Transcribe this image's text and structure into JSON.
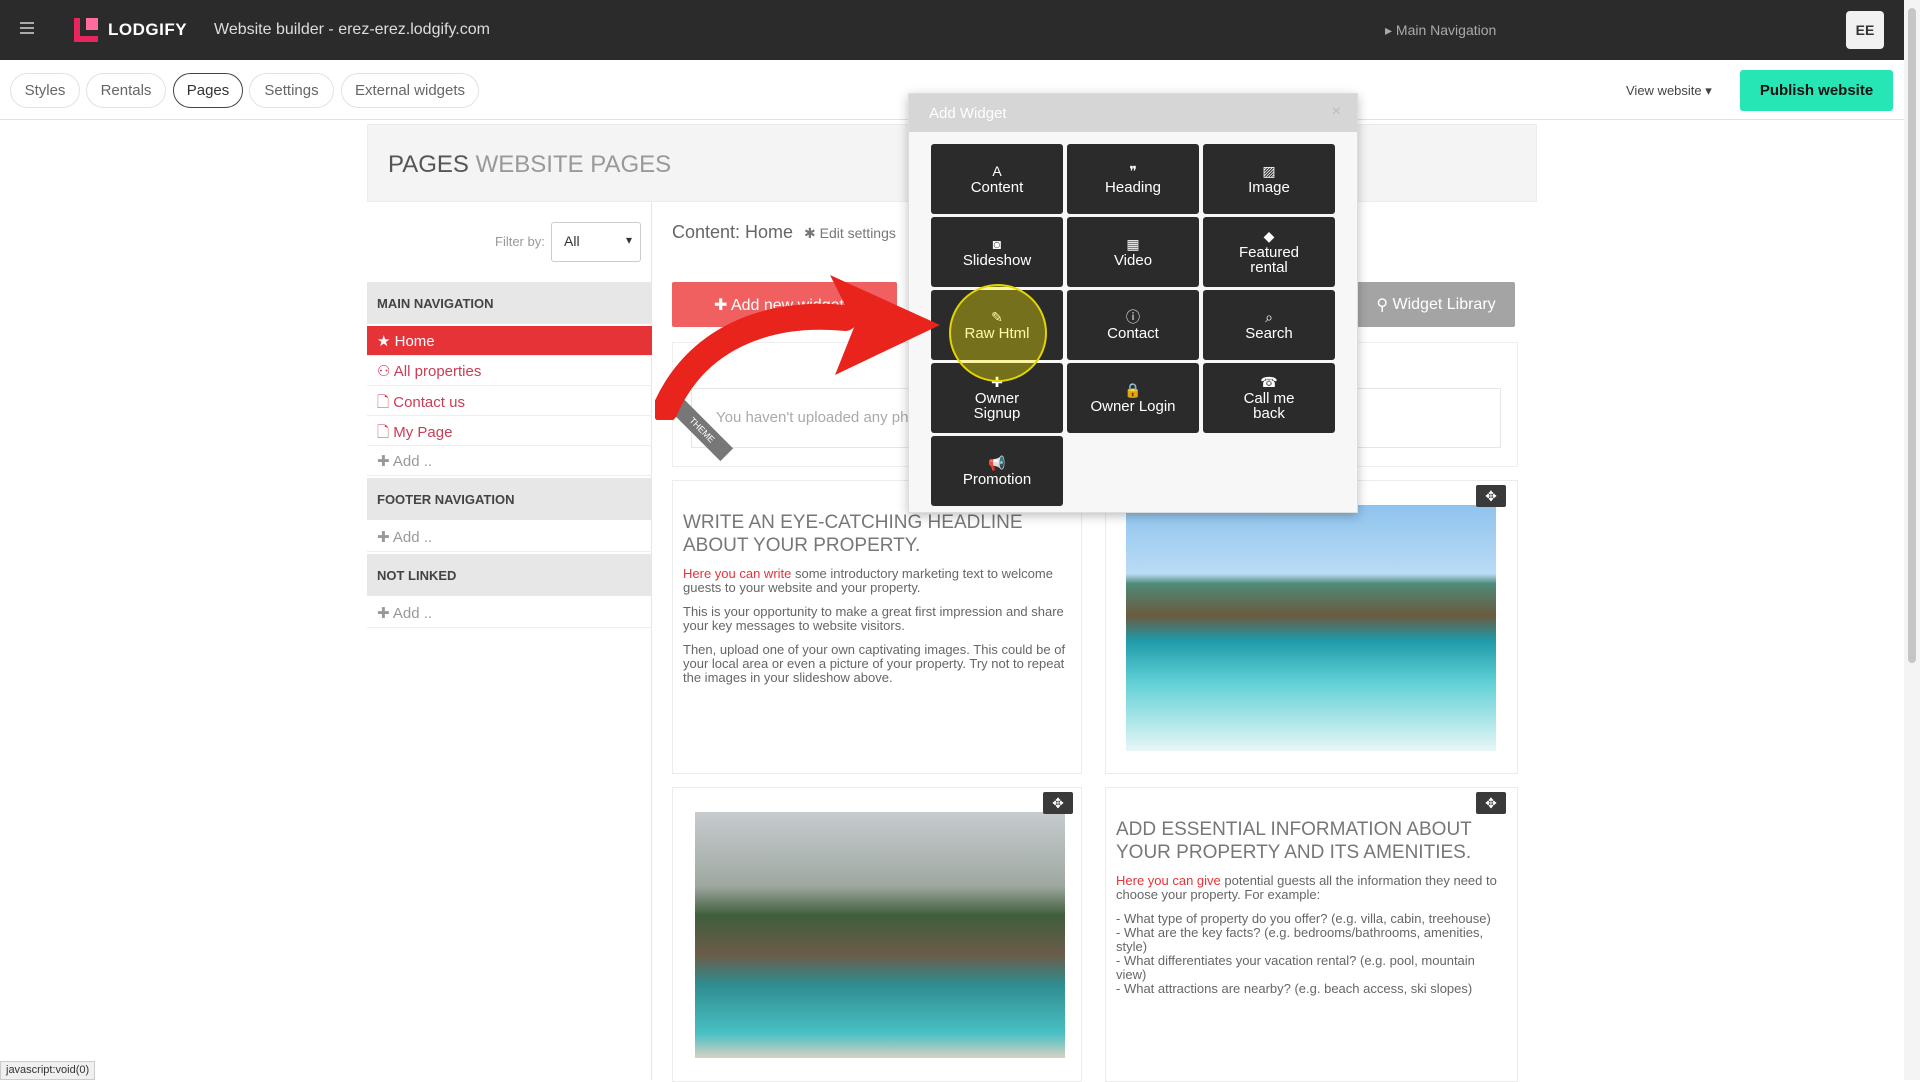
{
  "topbar": {
    "logo": "LODGIFY",
    "title": "Website builder - erez-erez.lodgify.com",
    "avatar": "EE"
  },
  "toolbar": {
    "tabs": [
      {
        "label": "Styles"
      },
      {
        "label": "Rentals"
      },
      {
        "label": "Pages"
      },
      {
        "label": "Settings"
      },
      {
        "label": "External widgets"
      }
    ],
    "view_website": "View website ▾",
    "publish": "Publish website"
  },
  "header": {
    "pages": "PAGES",
    "website_pages": "WEBSITE PAGES"
  },
  "sidebar": {
    "filter_label": "Filter by:",
    "filter_value": "All",
    "main_nav": "MAIN NAVIGATION",
    "items": [
      {
        "icon": "★",
        "label": "Home"
      },
      {
        "icon": "⚇",
        "label": "All properties"
      },
      {
        "icon": "🗋",
        "label": "Contact us"
      },
      {
        "icon": "🗋",
        "label": "My Page"
      }
    ],
    "add": "✚ Add ..",
    "footer_nav": "FOOTER NAVIGATION",
    "not_linked": "NOT LINKED"
  },
  "main": {
    "content_label": "Content: Home",
    "edit_settings": "✱ Edit settings",
    "breadcrumb": "▸ Main Navigation",
    "add_widget": "✚ Add new widget",
    "widget_library": "Widget Library",
    "upload_text": "You haven't uploaded any ph",
    "theme": "THEME",
    "card1": {
      "title": "WRITE AN EYE-CATCHING HEADLINE ABOUT YOUR PROPERTY.",
      "p1_red": "Here you can write",
      "p1": " some introductory marketing text to welcome guests to your website and your property.",
      "p2": "This is your opportunity to make a great first impression and share your key messages to website visitors.",
      "p3": "Then, upload one of your own captivating images. This could be of your local area or even a picture of your property. Try not to repeat the images in your slideshow above."
    },
    "card2": {
      "title": "ADD ESSENTIAL INFORMATION ABOUT YOUR PROPERTY AND ITS AMENITIES.",
      "p1_red": "Here you can give",
      "p1": " potential guests all the information they need to choose your property. For example:",
      "list": [
        "- What type of property do you offer? (e.g. villa, cabin, treehouse)",
        "- What are the key facts? (e.g. bedrooms/bathrooms, amenities, style)",
        "- What differentiates your vacation rental? (e.g. pool, mountain view)",
        "- What attractions are nearby? (e.g. beach access, ski slopes)"
      ]
    }
  },
  "modal": {
    "title": "Add Widget",
    "widgets": [
      {
        "icon": "A",
        "label": "Content"
      },
      {
        "icon": "❞",
        "label": "Heading"
      },
      {
        "icon": "▨",
        "label": "Image"
      },
      {
        "icon": "◙",
        "label": "Slideshow"
      },
      {
        "icon": "▦",
        "label": "Video"
      },
      {
        "icon": "◆",
        "label": "Featured rental"
      },
      {
        "icon": "✎",
        "label": "Raw Html"
      },
      {
        "icon": "ⓘ",
        "label": "Contact"
      },
      {
        "icon": "⌕",
        "label": "Search"
      },
      {
        "icon": "✚",
        "label": "Owner Signup"
      },
      {
        "icon": "🔒",
        "label": "Owner Login"
      },
      {
        "icon": "☎",
        "label": "Call me back"
      },
      {
        "icon": "📢",
        "label": "Promotion"
      }
    ]
  },
  "status_bar": "javascript:void(0)"
}
